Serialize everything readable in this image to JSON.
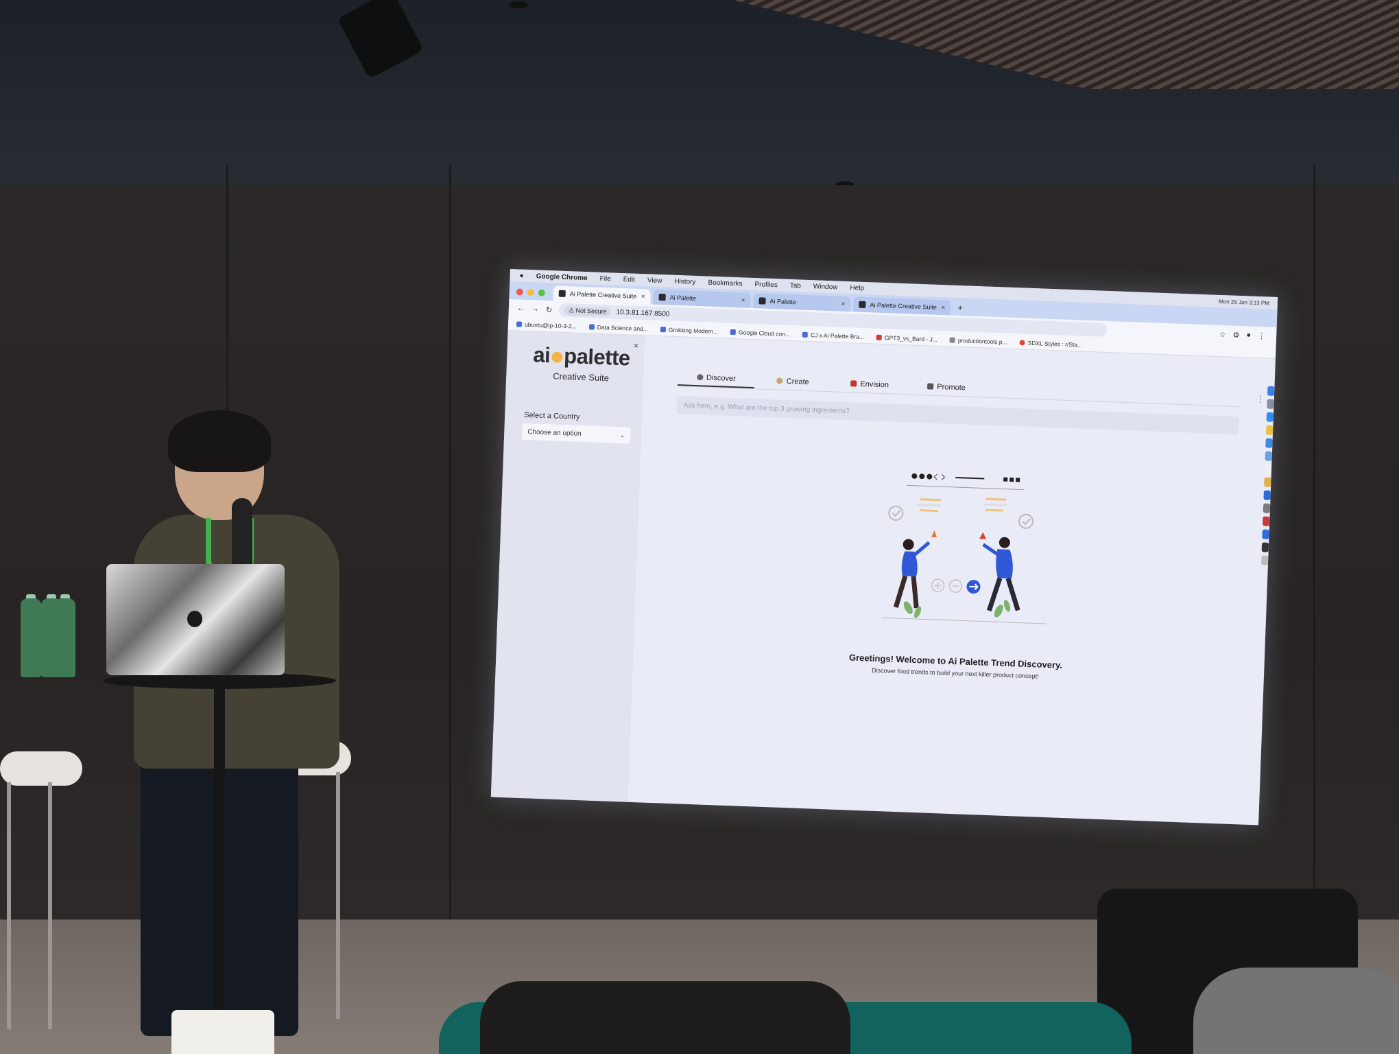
{
  "menubar": {
    "app": "Google Chrome",
    "items": [
      "File",
      "Edit",
      "View",
      "History",
      "Bookmarks",
      "Profiles",
      "Tab",
      "Window",
      "Help"
    ],
    "clock": "Mon 29 Jan 3:13 PM"
  },
  "browser": {
    "tabs": [
      {
        "title": "Ai Palette Creative Suite",
        "active": true
      },
      {
        "title": "Ai Palette",
        "active": false
      },
      {
        "title": "Ai Palette",
        "active": false
      },
      {
        "title": "Ai Palette Creative Suite",
        "active": false
      }
    ],
    "security_label": "Not Secure",
    "url": "10.3.81.167:8500",
    "bookmarks": [
      "ubuntu@ip-10-3-2...",
      "Data Science and...",
      "Grokking Modern...",
      "Google Cloud con...",
      "CJ x Ai Palette Bra...",
      "GPT3_vs_Bard - J...",
      "productiontools p...",
      "SDXL Styles : r/Sta..."
    ]
  },
  "sidebar": {
    "logo_left": "ai",
    "logo_right": "palette",
    "subtitle": "Creative Suite",
    "close_label": "×",
    "country_label": "Select a Country",
    "country_placeholder": "Choose an option"
  },
  "main": {
    "tabs": [
      {
        "label": "Discover",
        "icon": "magnifier-icon",
        "selected": true
      },
      {
        "label": "Create",
        "icon": "palette-icon",
        "selected": false
      },
      {
        "label": "Envision",
        "icon": "picture-icon",
        "selected": false
      },
      {
        "label": "Promote",
        "icon": "flag-icon",
        "selected": false
      }
    ],
    "ask_placeholder": "Ask here, e.g. What are the top 3 growing ingredients?",
    "greeting": "Greetings! Welcome to Ai Palette Trend Discovery.",
    "greeting_sub": "Discover food trends to build your next killer product concept!"
  },
  "colors": {
    "screen_bg": "#e9ebf6",
    "sidebar_bg": "#e1e3ee",
    "logo_dot": "#f4b347",
    "accent_blue": "#2f57d6",
    "tab_strip": "#c9d7f4"
  }
}
